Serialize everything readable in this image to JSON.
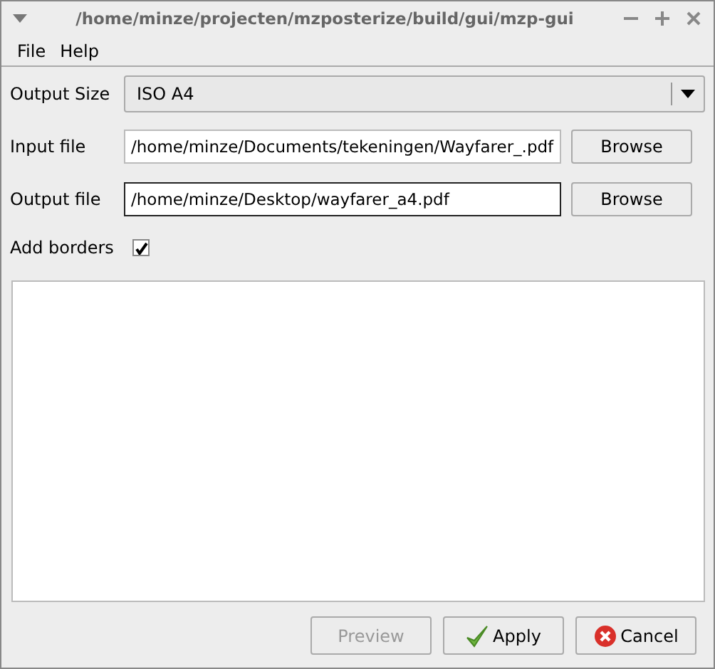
{
  "window": {
    "title": "/home/minze/projecten/mzposterize/build/gui/mzp-gui"
  },
  "menu": [
    "File",
    "Help"
  ],
  "output_size": {
    "label": "Output Size",
    "value": "ISO A4"
  },
  "input_file": {
    "label": "Input file",
    "value": "/home/minze/Documents/tekeningen/Wayfarer_.pdf",
    "button": "Browse",
    "focused": false
  },
  "output_file": {
    "label": "Output file",
    "value": "/home/minze/Desktop/wayfarer_a4.pdf",
    "button": "Browse",
    "focused": true
  },
  "add_borders": {
    "label": "Add borders",
    "checked": true
  },
  "buttons": [
    {
      "label": "Preview",
      "kind": "preview",
      "disabled": true
    },
    {
      "label": "Apply",
      "kind": "apply",
      "disabled": false
    },
    {
      "label": "Cancel",
      "kind": "cancel",
      "disabled": false
    }
  ]
}
